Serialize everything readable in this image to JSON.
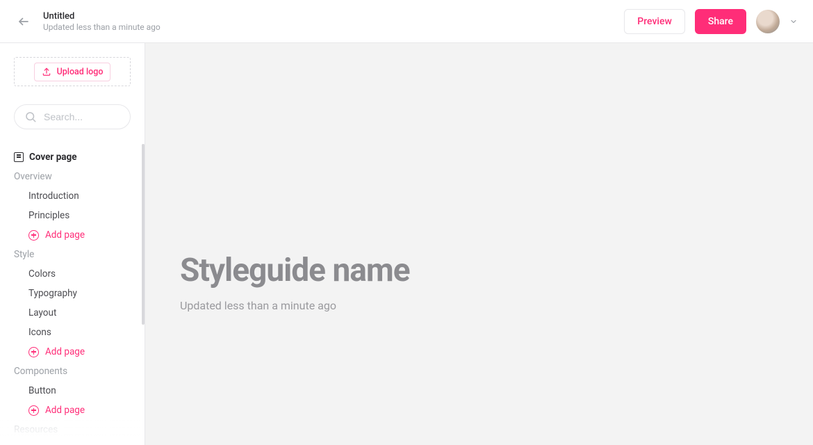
{
  "header": {
    "title": "Untitled",
    "subtitle": "Updated less than a minute ago",
    "preview_label": "Preview",
    "share_label": "Share"
  },
  "sidebar": {
    "upload_label": "Upload logo",
    "search_placeholder": "Search...",
    "cover_label": "Cover page",
    "add_page_label": "Add page",
    "sections": [
      {
        "title": "Overview",
        "items": [
          "Introduction",
          "Principles"
        ]
      },
      {
        "title": "Style",
        "items": [
          "Colors",
          "Typography",
          "Layout",
          "Icons"
        ]
      },
      {
        "title": "Components",
        "items": [
          "Button"
        ]
      }
    ],
    "partial_section_title": "Resources"
  },
  "canvas": {
    "title": "Styleguide name",
    "subtitle": "Updated less than a minute ago"
  },
  "colors": {
    "accent": "#ff2d78"
  }
}
